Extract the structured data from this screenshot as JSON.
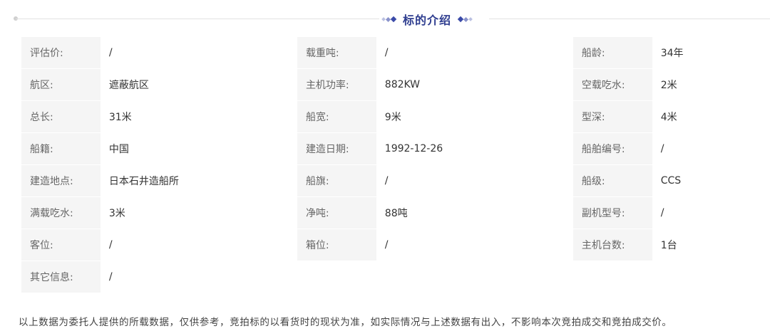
{
  "section": {
    "title": "标的介绍"
  },
  "rows": [
    [
      {
        "label": "评估价:",
        "value": "/"
      },
      {
        "label": "载重吨:",
        "value": "/"
      },
      {
        "label": "船龄:",
        "value": "34年"
      }
    ],
    [
      {
        "label": "航区:",
        "value": "遮蔽航区"
      },
      {
        "label": "主机功率:",
        "value": "882KW"
      },
      {
        "label": "空载吃水:",
        "value": "2米"
      }
    ],
    [
      {
        "label": "总长:",
        "value": "31米"
      },
      {
        "label": "船宽:",
        "value": "9米"
      },
      {
        "label": "型深:",
        "value": "4米"
      }
    ],
    [
      {
        "label": "船籍:",
        "value": "中国"
      },
      {
        "label": "建造日期:",
        "value": "1992-12-26"
      },
      {
        "label": "船舶编号:",
        "value": "/"
      }
    ],
    [
      {
        "label": "建造地点:",
        "value": "日本石井造船所"
      },
      {
        "label": "船旗:",
        "value": "/"
      },
      {
        "label": "船级:",
        "value": "CCS"
      }
    ],
    [
      {
        "label": "满载吃水:",
        "value": "3米"
      },
      {
        "label": "净吨:",
        "value": "88吨"
      },
      {
        "label": "副机型号:",
        "value": "/"
      }
    ],
    [
      {
        "label": "客位:",
        "value": "/"
      },
      {
        "label": "箱位:",
        "value": "/"
      },
      {
        "label": "主机台数:",
        "value": "1台"
      }
    ],
    [
      {
        "label": "其它信息:",
        "value": "/"
      }
    ]
  ],
  "note": "以上数据为委托人提供的所载数据，仅供参考，竞拍标的以看货时的现状为准，如实际情况与上述数据有出入，不影响本次竞拍成交和竞拍成交价。"
}
